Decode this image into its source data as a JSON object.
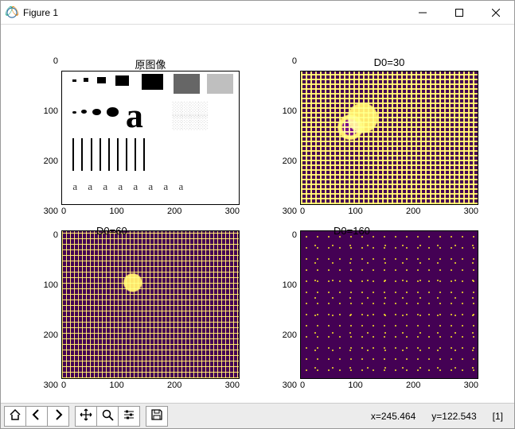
{
  "window": {
    "title": "Figure 1",
    "buttons": {
      "min": "–",
      "max": "□",
      "close": "×"
    }
  },
  "chart_data": [
    {
      "type": "heatmap",
      "title": "原图像",
      "xlim": [
        0,
        300
      ],
      "ylim": [
        0,
        300
      ],
      "xticks": [
        0,
        100,
        200,
        300
      ],
      "yticks": [
        0,
        100,
        200,
        300
      ],
      "content": "original test image: squares, circles, letter 'a', vertical bars, row of 'a a a a a a a a'"
    },
    {
      "type": "heatmap",
      "title": "D0=30",
      "xlim": [
        0,
        300
      ],
      "ylim": [
        0,
        300
      ],
      "xticks": [
        0,
        100,
        200,
        300
      ],
      "yticks": [
        0,
        100,
        200,
        300
      ],
      "content": "high-pass / filtered result D0=30, dense yellow ringing on purple"
    },
    {
      "type": "heatmap",
      "title": "D0=60",
      "xlim": [
        0,
        300
      ],
      "ylim": [
        0,
        300
      ],
      "xticks": [
        0,
        100,
        200,
        300
      ],
      "yticks": [
        0,
        100,
        200,
        300
      ],
      "content": "filtered result D0=60, moderate yellow edges on purple"
    },
    {
      "type": "heatmap",
      "title": "D0=160",
      "xlim": [
        0,
        300
      ],
      "ylim": [
        0,
        300
      ],
      "xticks": [
        0,
        100,
        200,
        300
      ],
      "yticks": [
        0,
        100,
        200,
        300
      ],
      "content": "filtered result D0=160, sparse yellow dots on purple"
    }
  ],
  "xlabels": [
    "0",
    "100",
    "200",
    "300"
  ],
  "ylabels": [
    "0",
    "100",
    "200",
    "300"
  ],
  "toolbar": {
    "home": "home-icon",
    "back": "back-icon",
    "forward": "forward-icon",
    "pan": "pan-icon",
    "zoom": "zoom-icon",
    "configure": "configure-icon",
    "save": "save-icon"
  },
  "status": {
    "x": "x=245.464",
    "y": "y=122.543",
    "extra": "[1]"
  }
}
